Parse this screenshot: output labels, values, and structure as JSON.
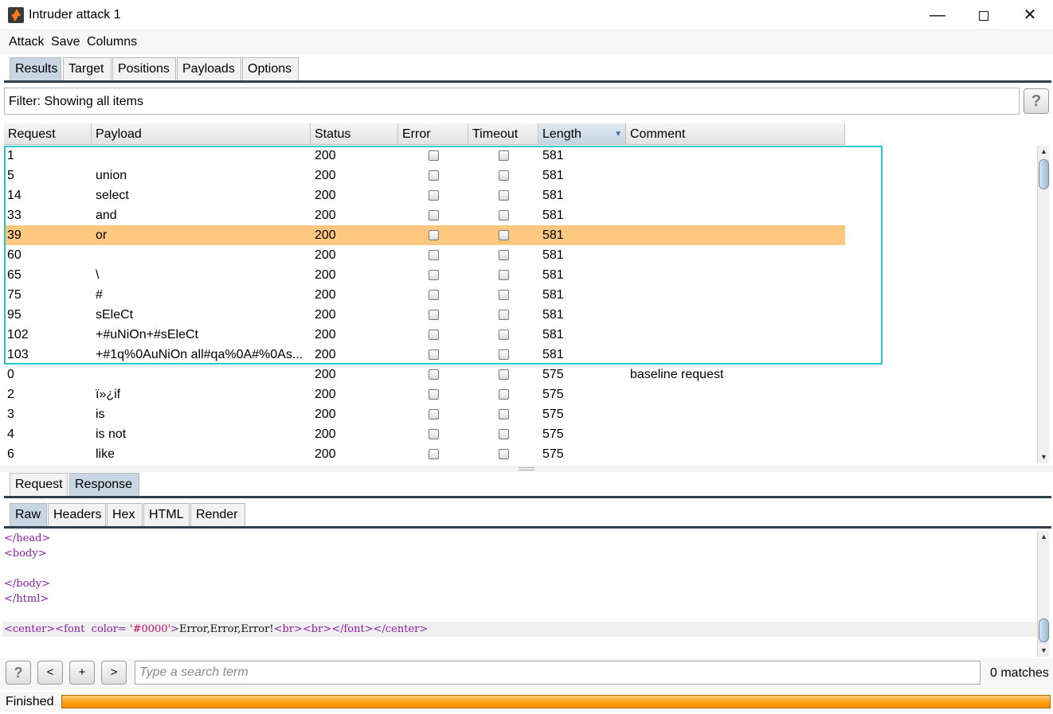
{
  "window": {
    "title": "Intruder attack 1",
    "minimize": "—",
    "close": "✕"
  },
  "menu": {
    "attack": "Attack",
    "save": "Save",
    "columns": "Columns"
  },
  "main_tabs": [
    "Results",
    "Target",
    "Positions",
    "Payloads",
    "Options"
  ],
  "filter": {
    "text": "Filter: Showing all items",
    "help": "?"
  },
  "table": {
    "columns": [
      "Request",
      "Payload",
      "Status",
      "Error",
      "Timeout",
      "Length",
      "Comment"
    ],
    "sorted_column": "Length",
    "rows": [
      {
        "request": "1",
        "payload": "",
        "status": "200",
        "error": false,
        "timeout": false,
        "length": "581",
        "comment": ""
      },
      {
        "request": "5",
        "payload": "union",
        "status": "200",
        "error": false,
        "timeout": false,
        "length": "581",
        "comment": ""
      },
      {
        "request": "14",
        "payload": "select",
        "status": "200",
        "error": false,
        "timeout": false,
        "length": "581",
        "comment": ""
      },
      {
        "request": "33",
        "payload": "and",
        "status": "200",
        "error": false,
        "timeout": false,
        "length": "581",
        "comment": ""
      },
      {
        "request": "39",
        "payload": "or",
        "status": "200",
        "error": false,
        "timeout": false,
        "length": "581",
        "comment": ""
      },
      {
        "request": "60",
        "payload": "",
        "status": "200",
        "error": false,
        "timeout": false,
        "length": "581",
        "comment": ""
      },
      {
        "request": "65",
        "payload": "\\",
        "status": "200",
        "error": false,
        "timeout": false,
        "length": "581",
        "comment": ""
      },
      {
        "request": "75",
        "payload": "#",
        "status": "200",
        "error": false,
        "timeout": false,
        "length": "581",
        "comment": ""
      },
      {
        "request": "95",
        "payload": "sEleCt",
        "status": "200",
        "error": false,
        "timeout": false,
        "length": "581",
        "comment": ""
      },
      {
        "request": "102",
        "payload": "+#uNiOn+#sEleCt",
        "status": "200",
        "error": false,
        "timeout": false,
        "length": "581",
        "comment": ""
      },
      {
        "request": "103",
        "payload": "+#1q%0AuNiOn all#qa%0A#%0As...",
        "status": "200",
        "error": false,
        "timeout": false,
        "length": "581",
        "comment": ""
      },
      {
        "request": "0",
        "payload": "",
        "status": "200",
        "error": false,
        "timeout": false,
        "length": "575",
        "comment": "baseline request"
      },
      {
        "request": "2",
        "payload": "ï»¿if",
        "status": "200",
        "error": false,
        "timeout": false,
        "length": "575",
        "comment": ""
      },
      {
        "request": "3",
        "payload": "is",
        "status": "200",
        "error": false,
        "timeout": false,
        "length": "575",
        "comment": ""
      },
      {
        "request": "4",
        "payload": "is not",
        "status": "200",
        "error": false,
        "timeout": false,
        "length": "575",
        "comment": ""
      },
      {
        "request": "6",
        "payload": "like",
        "status": "200",
        "error": false,
        "timeout": false,
        "length": "575",
        "comment": ""
      }
    ],
    "selected_row": 4
  },
  "message_tabs": [
    "Request",
    "Response"
  ],
  "message_active": "Response",
  "view_tabs": [
    "Raw",
    "Headers",
    "Hex",
    "HTML",
    "Render"
  ],
  "view_active": "Raw",
  "response_lines": [
    "</head>",
    "<body>",
    "",
    "</body>",
    "</html>",
    "",
    "<center><font  color= '#0000'>Error,Error,Error!<br><br></font></center>"
  ],
  "search": {
    "help": "?",
    "prev": "<",
    "add": "+",
    "next": ">",
    "placeholder": "Type a search term",
    "matches": "0 matches"
  },
  "status": {
    "text": "Finished",
    "progress": 1.0
  },
  "colors": {
    "selected_row": "#ffc880",
    "highlight_border": "#27c7cc",
    "active_tab": "#c8d6e4",
    "progress": "#ff9a0a"
  }
}
